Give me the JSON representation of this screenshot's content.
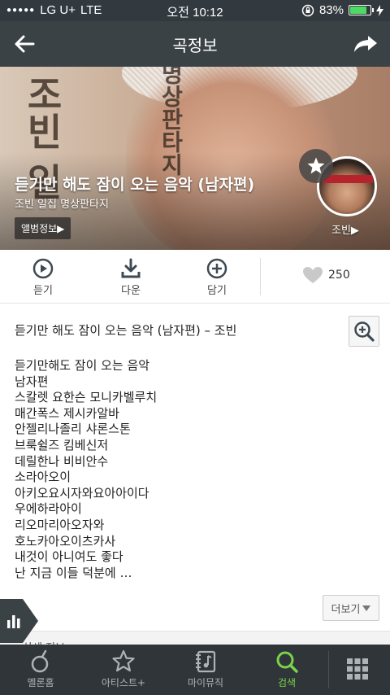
{
  "status_bar": {
    "carrier": "LG U+",
    "network": "LTE",
    "time": "오전 10:12",
    "battery": "83%",
    "battery_level": 0.83
  },
  "header": {
    "title": "곡정보",
    "back_icon": "back-arrow-icon",
    "share_icon": "share-arrow-icon"
  },
  "hero": {
    "song_title": "듣기만 해도 잠이 오는 음악 (남자편)",
    "album_line": "조빈 일집 명상판타지",
    "album_info_button": "앨범정보▶",
    "artist_link": "조빈▶",
    "cover_calligraphy_left": "조빈 일",
    "cover_calligraphy_right": "명상판타지"
  },
  "actions": {
    "listen": "듣기",
    "download": "다운",
    "add": "담기",
    "like_count": "250"
  },
  "lyrics": {
    "title": "듣기만 해도 잠이 오는 음악 (남자편) – 조빈",
    "lines": [
      "듣기만해도 잠이 오는 음악",
      "남자편",
      "스칼렛 요한슨 모니카벨루치",
      "매간폭스 제시카알바",
      "안젤리나졸리 샤론스톤",
      "브룩쉴즈 킴베신저",
      "데릴한나 비비안수",
      "소라아오이",
      "아키오요시자와요아아이다",
      "우에하라아이",
      "리오마리아오자와",
      "호노카아오이츠카사",
      "내것이 아니여도 좋다",
      "난 지금 이들 덕분에 …"
    ],
    "more_button": "더보기"
  },
  "section_strip": {
    "label": "상세 정보"
  },
  "tab_bar": {
    "items": [
      {
        "label": "멜론홈",
        "icon": "melon-home-icon"
      },
      {
        "label": "아티스트+",
        "icon": "star-icon"
      },
      {
        "label": "마이뮤직",
        "icon": "my-music-icon"
      },
      {
        "label": "검색",
        "icon": "search-icon"
      }
    ],
    "active_color": "#7bd24b",
    "menu_icon": "grid-menu-icon"
  }
}
